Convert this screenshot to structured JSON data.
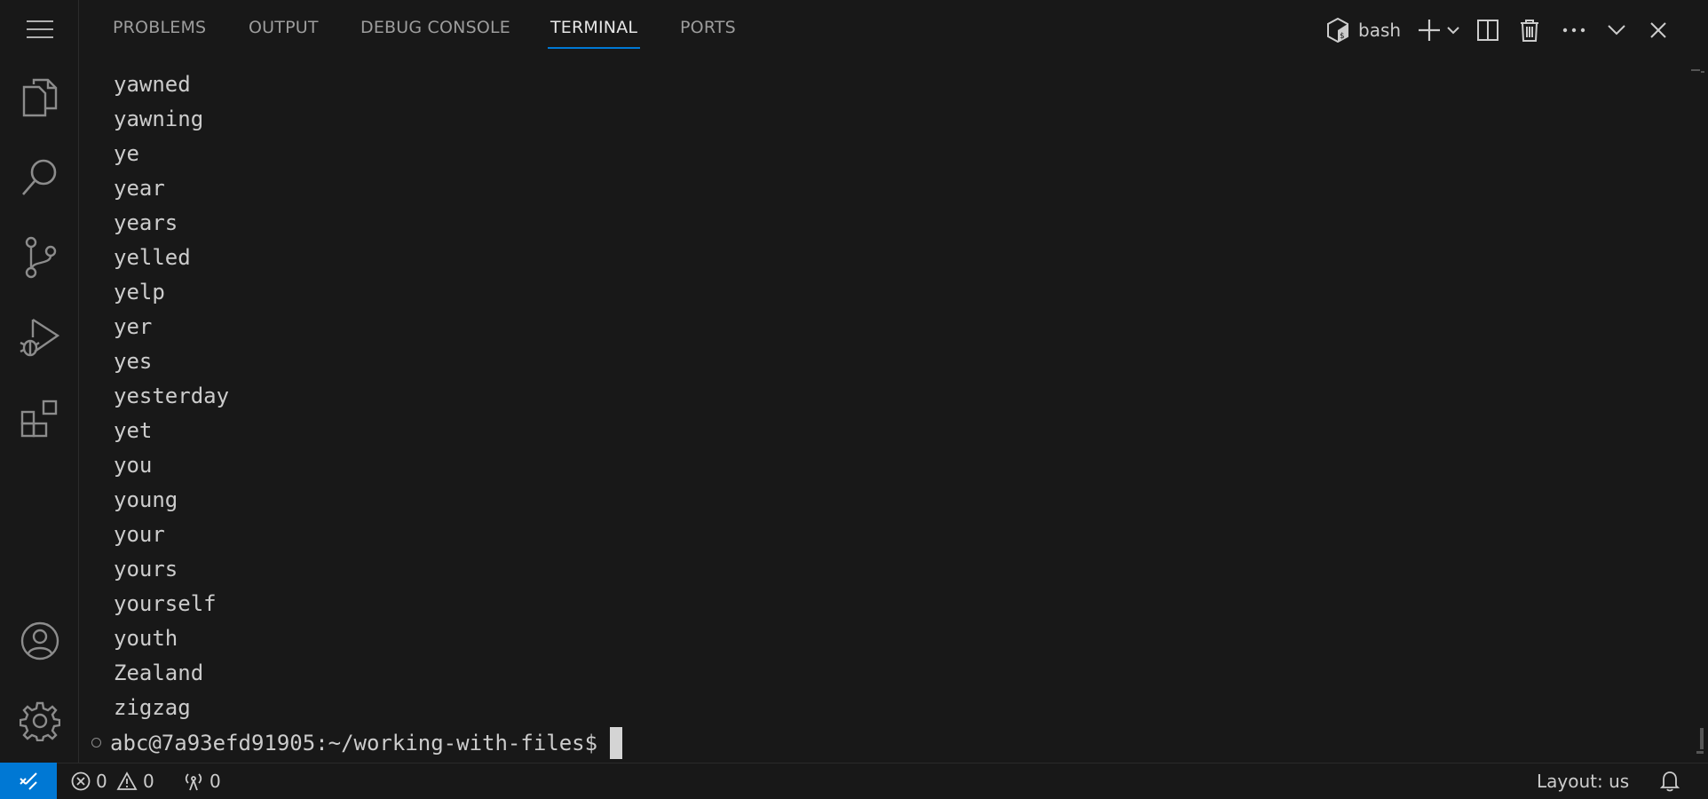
{
  "panel": {
    "tabs": [
      {
        "label": "PROBLEMS"
      },
      {
        "label": "OUTPUT"
      },
      {
        "label": "DEBUG CONSOLE"
      },
      {
        "label": "TERMINAL"
      },
      {
        "label": "PORTS"
      }
    ],
    "active_tab": "TERMINAL",
    "terminal_shell": "bash"
  },
  "terminal": {
    "lines": [
      "yawned",
      "yawning",
      "ye",
      "year",
      "years",
      "yelled",
      "yelp",
      "yer",
      "yes",
      "yesterday",
      "yet",
      "you",
      "young",
      "your",
      "yours",
      "yourself",
      "youth",
      "Zealand",
      "zigzag"
    ],
    "prompt": "abc@7a93efd91905:~/working-with-files$"
  },
  "activity_bar": {
    "items": [
      "menu-icon",
      "explorer-icon",
      "search-icon",
      "source-control-icon",
      "run-debug-icon",
      "extensions-icon",
      "accounts-icon",
      "settings-gear-icon"
    ]
  },
  "status_bar": {
    "errors": "0",
    "warnings": "0",
    "ports": "0",
    "layout": "Layout: us"
  },
  "colors": {
    "background": "#181818",
    "accent": "#0078d4",
    "text": "#cccccc",
    "muted": "#9d9d9d"
  }
}
